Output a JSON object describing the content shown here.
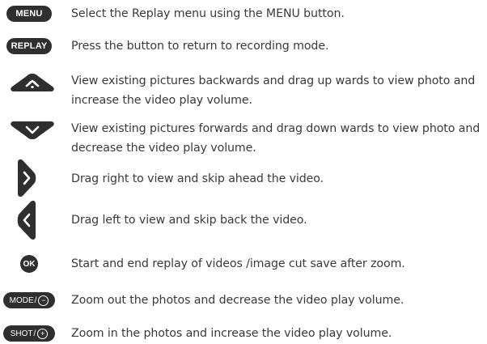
{
  "rows": [
    {
      "icon": "menu-button-icon",
      "label": "MENU",
      "text": "Select the Replay menu using the MENU button."
    },
    {
      "icon": "replay-button-icon",
      "label": "REPLAY",
      "text": "Press the button to return to recording mode."
    },
    {
      "icon": "up-arrow-button-icon",
      "text": "View existing pictures backwards and drag up wards to view photo and increase the video play volume."
    },
    {
      "icon": "down-arrow-button-icon",
      "text": "View existing pictures forwards and drag down wards to view photo and decrease  the video play volume."
    },
    {
      "icon": "right-arrow-button-icon",
      "text": "Drag right to view and skip ahead the video."
    },
    {
      "icon": "left-arrow-button-icon",
      "text": "Drag left to view and skip back the video."
    },
    {
      "icon": "ok-button-icon",
      "label": "OK",
      "text": "Start and end replay of videos /image cut save after zoom."
    },
    {
      "icon": "mode-minus-button-icon",
      "label": "MODE",
      "symbol": "−",
      "text": "Zoom out the photos and decrease the video play volume."
    },
    {
      "icon": "shot-plus-button-icon",
      "label": "SHOT",
      "symbol": "+",
      "text": "Zoom in the photos and increase the video play volume."
    }
  ],
  "colors": {
    "icon_fill": "#2f2f2f",
    "text": "#3a3a3a"
  }
}
